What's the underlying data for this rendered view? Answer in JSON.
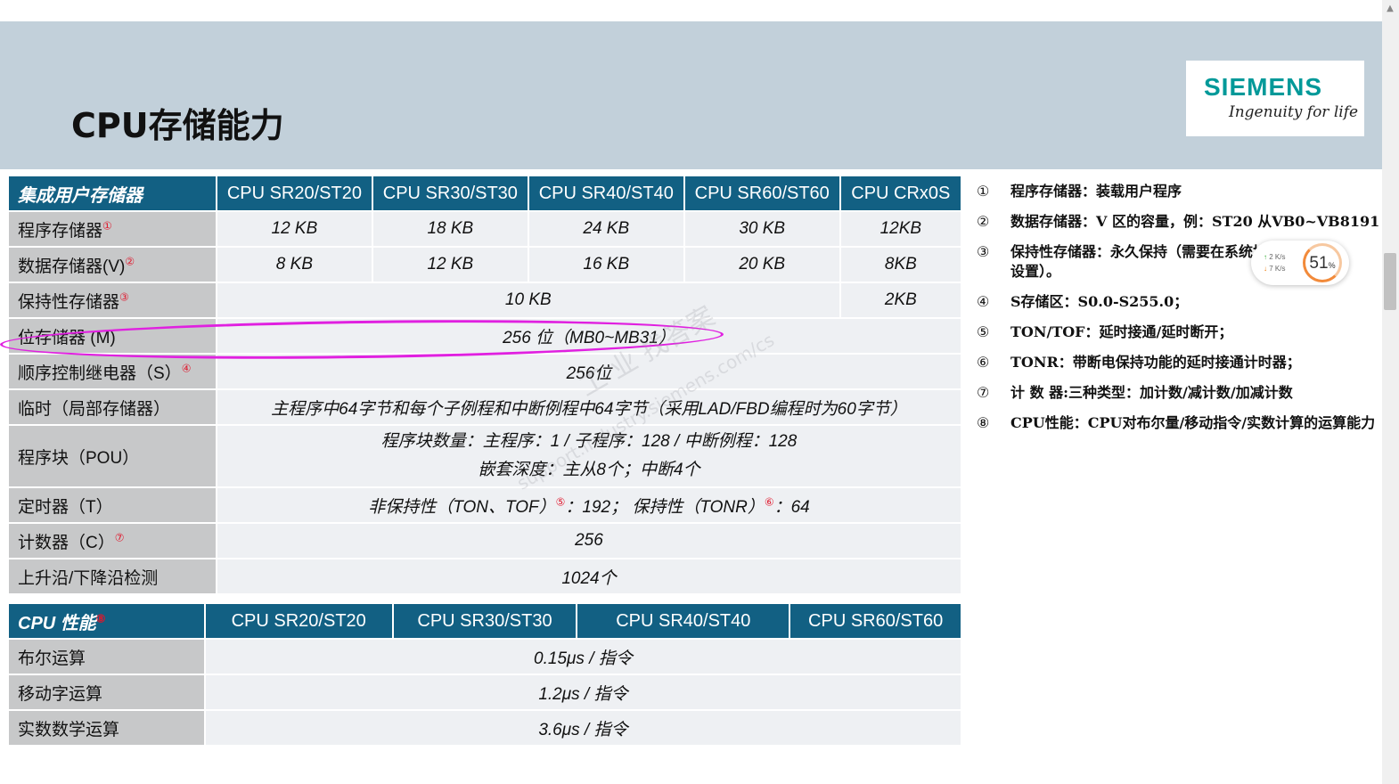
{
  "slide": {
    "title": "CPU存储能力"
  },
  "logo": {
    "brand": "SIEMENS",
    "tagline": "Ingenuity for life"
  },
  "memory_table": {
    "header": [
      "集成用户存储器",
      "CPU SR20/ST20",
      "CPU SR30/ST30",
      "CPU SR40/ST40",
      "CPU SR60/ST60",
      "CPU CRx0S"
    ],
    "rows": {
      "program": {
        "label": "程序存储器",
        "marker": "①",
        "values": [
          "12 KB",
          "18 KB",
          "24 KB",
          "30 KB",
          "12KB"
        ]
      },
      "data": {
        "label": "数据存储器(V)",
        "marker": "②",
        "values": [
          "8 KB",
          "12 KB",
          "16 KB",
          "20 KB",
          "8KB"
        ]
      },
      "retentive": {
        "label": "保持性存储器",
        "marker": "③",
        "value": "10 KB",
        "crx": "2KB"
      },
      "bit": {
        "label": "位存储器 (M)",
        "value": "256 位（MB0~MB31）"
      },
      "seq": {
        "label": "顺序控制继电器（S）",
        "marker": "④",
        "value": "256位"
      },
      "temp": {
        "label": "临时（局部存储器）",
        "value": "主程序中64字节和每个子例程和中断例程中64字节（采用LAD/FBD编程时为60字节）"
      },
      "pou": {
        "label": "程序块（POU）",
        "line1": "程序块数量：主程序：1 / 子程序：128 / 中断例程：128",
        "line2": "嵌套深度：主从8个；中断4个"
      },
      "timer": {
        "label": "定时器（T）",
        "part1": "非保持性（TON、TOF）",
        "marker1": "⑤",
        "part2": "：192； 保持性（TONR）",
        "marker2": "⑥",
        "part3": "：64"
      },
      "counter": {
        "label": "计数器（C）",
        "marker": "⑦",
        "value": "256"
      },
      "edge": {
        "label": "上升沿/下降沿检测",
        "value": "1024个"
      }
    }
  },
  "perf_table": {
    "header": [
      "CPU 性能",
      "CPU SR20/ST20",
      "CPU SR30/ST30",
      "CPU SR40/ST40",
      "CPU SR60/ST60"
    ],
    "header_marker": "⑧",
    "rows": [
      {
        "label": "布尔运算",
        "value": "0.15μs / 指令"
      },
      {
        "label": "移动字运算",
        "value": "1.2μs / 指令"
      },
      {
        "label": "实数数学运算",
        "value": "3.6μs / 指令"
      }
    ]
  },
  "notes": [
    {
      "num": "①",
      "text": "程序存储器：装载用户程序"
    },
    {
      "num": "②",
      "text": "数据存储器：V 区的容量，例：ST20 从VB0~VB8191"
    },
    {
      "num": "③",
      "text": "保持性存储器：永久保持（需要在系统块中断电保",
      "text2": "设置）。"
    },
    {
      "num": "④",
      "text": "S存储区：S0.0-S255.0；"
    },
    {
      "num": "⑤",
      "text": "TON/TOF：延时接通/延时断开；"
    },
    {
      "num": "⑥",
      "text": "TONR：带断电保持功能的延时接通计时器；"
    },
    {
      "num": "⑦",
      "text": "计 数 器:三种类型：加计数/减计数/加减计数"
    },
    {
      "num": "⑧",
      "text": "CPU性能：CPU对布尔量/移动指令/实数计算的运算能力"
    }
  ],
  "watermark": {
    "text1": "工 业 找答案",
    "text2": "support.industry.siemens.com/cs"
  },
  "net_widget": {
    "up": "2 K/s",
    "down": "7 K/s",
    "percent": "51",
    "unit": "%"
  },
  "colors": {
    "header_band": "#c2d0da",
    "table_header": "#126083",
    "label_cell": "#c7c8c9",
    "value_cell": "#eef0f3",
    "highlight": "#e020e0",
    "brand": "#009999"
  }
}
